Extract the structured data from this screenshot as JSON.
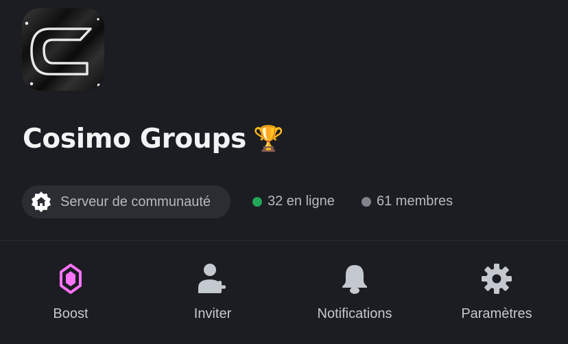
{
  "server": {
    "name": "Cosimo Groups",
    "emoji": "🏆",
    "icon_name": "server-logo-c"
  },
  "community_badge": {
    "icon": "community-home-icon",
    "label": "Serveur de communauté"
  },
  "stats": {
    "online": "32 en ligne",
    "members": "61 membres",
    "online_color": "#23a55a",
    "members_color": "#80848e"
  },
  "actions": [
    {
      "label": "Boost",
      "icon": "boost-gem-icon",
      "color": "#ff73fa"
    },
    {
      "label": "Inviter",
      "icon": "add-person-icon",
      "color": "#b5bac1"
    },
    {
      "label": "Notifications",
      "icon": "bell-icon",
      "color": "#b5bac1"
    },
    {
      "label": "Paramètres",
      "icon": "gear-icon",
      "color": "#b5bac1"
    }
  ]
}
